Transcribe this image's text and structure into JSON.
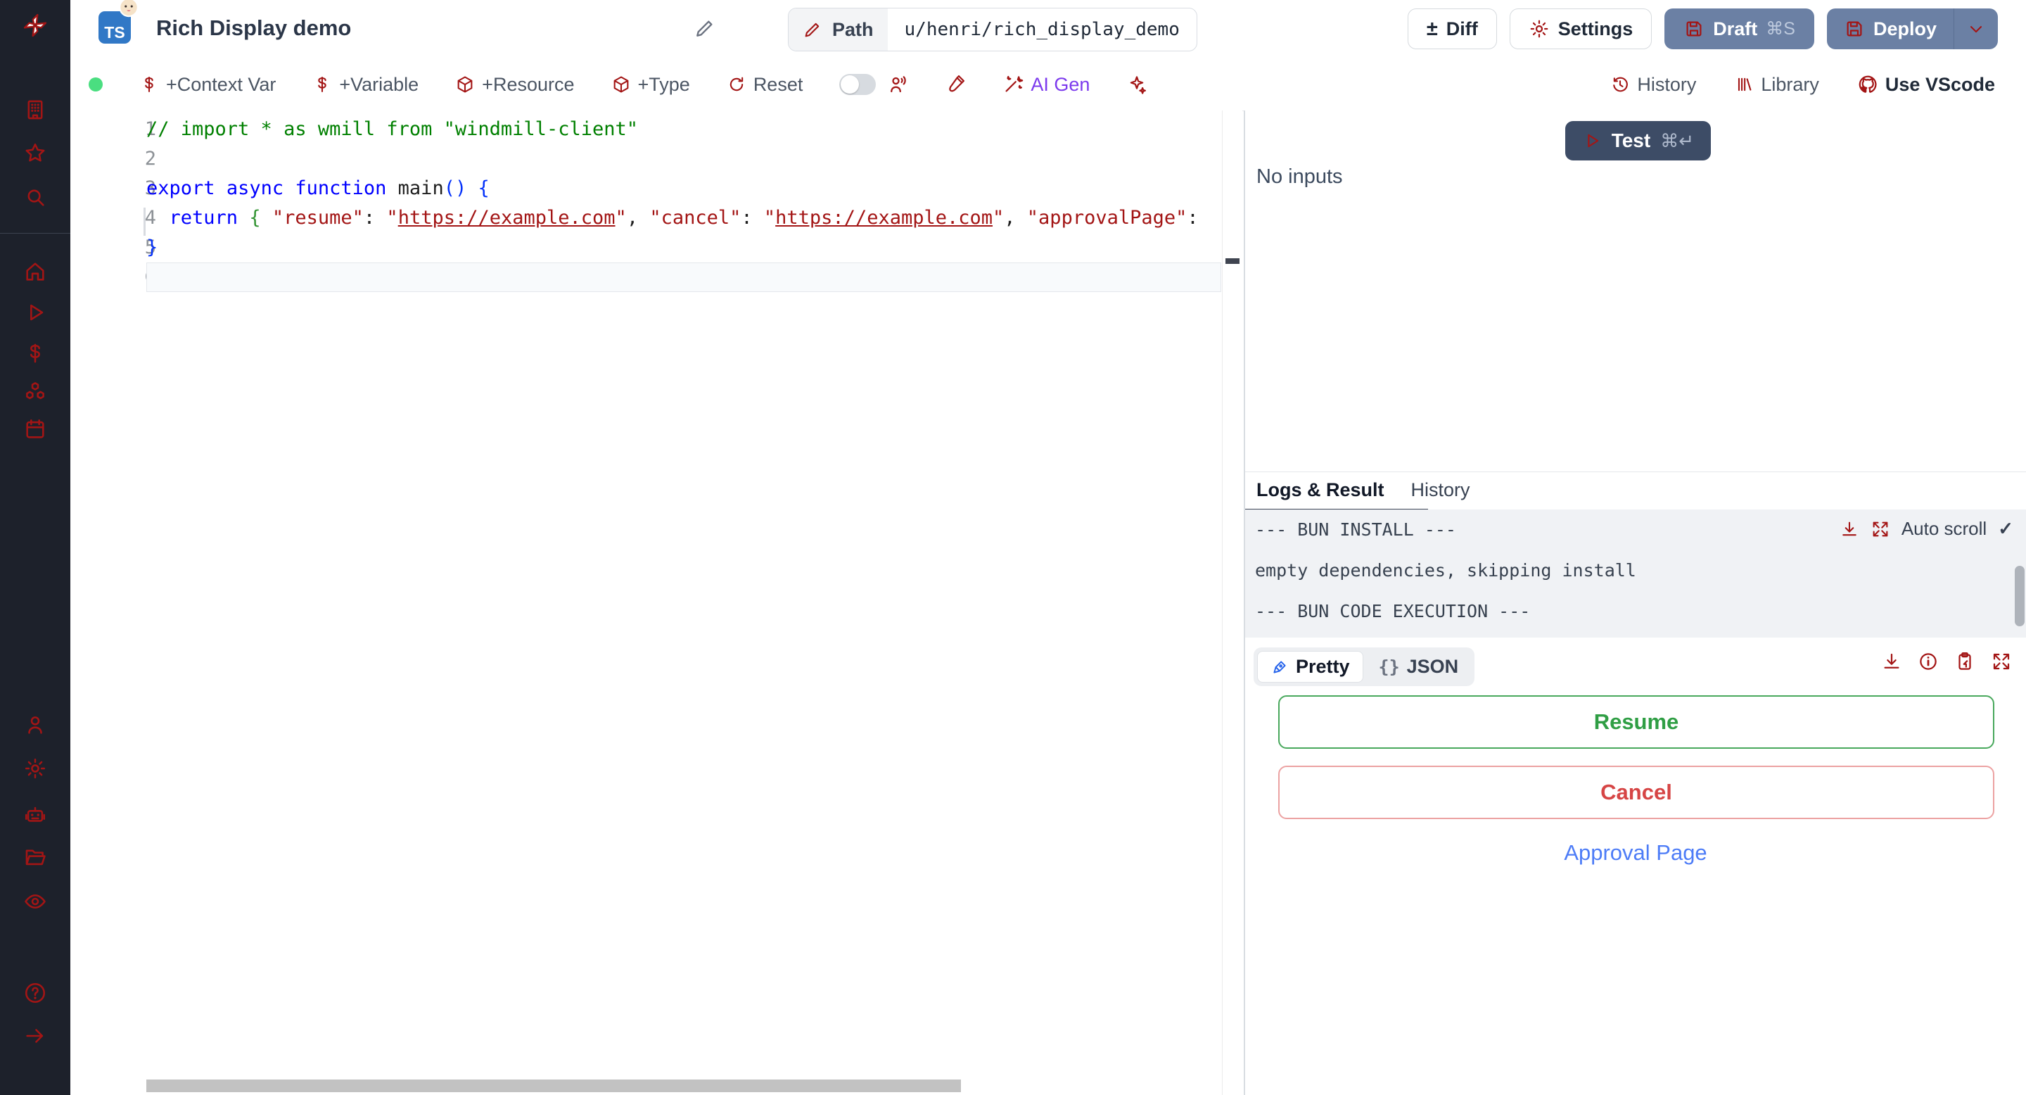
{
  "window": {
    "title": "Rich Display demo",
    "ts_badge": "TS"
  },
  "header": {
    "path_label": "Path",
    "path_value": "u/henri/rich_display_demo",
    "diff_label": "Diff",
    "settings_label": "Settings",
    "draft_label": "Draft",
    "draft_shortcut": "⌘S",
    "deploy_label": "Deploy"
  },
  "toolbar": {
    "context_var": "+Context Var",
    "variable": "+Variable",
    "resource": "+Resource",
    "type": "+Type",
    "reset": "Reset",
    "ai_gen": "AI Gen",
    "history": "History",
    "library": "Library",
    "vscode": "Use VScode"
  },
  "icons": {
    "diff_glyph": "±",
    "check_glyph": "✓",
    "dollar_glyph": "$",
    "sidebar_names": [
      "windmill-logo",
      "building",
      "star",
      "search",
      "home",
      "play",
      "dollar",
      "cubes",
      "calendar",
      "person",
      "gear",
      "robot",
      "folder-open",
      "eye",
      "question",
      "arrow-right"
    ]
  },
  "editor": {
    "lines": [
      {
        "n": "1",
        "tokens": [
          {
            "t": "// import * as wmill from \"windmill-client\"",
            "c": "cm"
          }
        ]
      },
      {
        "n": "2",
        "tokens": []
      },
      {
        "n": "3",
        "tokens": [
          {
            "t": "export",
            "c": "kw"
          },
          {
            "t": " ",
            "c": "pl"
          },
          {
            "t": "async",
            "c": "kw"
          },
          {
            "t": " ",
            "c": "pl"
          },
          {
            "t": "function",
            "c": "kw"
          },
          {
            "t": " ",
            "c": "pl"
          },
          {
            "t": "main",
            "c": "fn"
          },
          {
            "t": "()",
            "c": "b1"
          },
          {
            "t": " ",
            "c": "pl"
          },
          {
            "t": "{",
            "c": "b1"
          }
        ]
      },
      {
        "n": "4",
        "tokens": [
          {
            "t": "  ",
            "c": "pl"
          },
          {
            "t": "return",
            "c": "kw"
          },
          {
            "t": " ",
            "c": "pl"
          },
          {
            "t": "{",
            "c": "b2"
          },
          {
            "t": " ",
            "c": "pl"
          },
          {
            "t": "\"resume\"",
            "c": "st"
          },
          {
            "t": ": ",
            "c": "pl"
          },
          {
            "t": "\"",
            "c": "st"
          },
          {
            "t": "https://example.com",
            "c": "st lk"
          },
          {
            "t": "\"",
            "c": "st"
          },
          {
            "t": ", ",
            "c": "pl"
          },
          {
            "t": "\"cancel\"",
            "c": "st"
          },
          {
            "t": ": ",
            "c": "pl"
          },
          {
            "t": "\"",
            "c": "st"
          },
          {
            "t": "https://example.com",
            "c": "st lk"
          },
          {
            "t": "\"",
            "c": "st"
          },
          {
            "t": ", ",
            "c": "pl"
          },
          {
            "t": "\"approvalPage\"",
            "c": "st"
          },
          {
            "t": ":",
            "c": "pl"
          }
        ]
      },
      {
        "n": "5",
        "tokens": [
          {
            "t": "}",
            "c": "b1"
          }
        ]
      },
      {
        "n": "6",
        "tokens": [],
        "current": true
      }
    ]
  },
  "run": {
    "test_label": "Test",
    "test_shortcut": "⌘↵",
    "no_inputs": "No inputs"
  },
  "output": {
    "tabs": [
      {
        "label": "Logs & Result",
        "active": true
      },
      {
        "label": "History",
        "active": false
      }
    ],
    "auto_scroll": "Auto scroll",
    "logs": [
      "--- BUN INSTALL ---",
      "empty dependencies, skipping install",
      "--- BUN CODE EXECUTION ---"
    ],
    "view_pretty": "Pretty",
    "view_json_braces": "{}",
    "view_json": "JSON",
    "result": {
      "resume_label": "Resume",
      "cancel_label": "Cancel",
      "link_label": "Approval Page"
    }
  },
  "colors": {
    "resume_green": "#2f9e44",
    "cancel_red": "#d64545",
    "link_blue": "#4d7cf7",
    "header_button_slate": "#6b80a4",
    "test_navy": "#3d4c66",
    "ai_purple": "#7c3aed",
    "ts_badge_blue": "#3178c6",
    "sidebar_dark": "#1d212b",
    "status_dot_green": "#4ade80"
  }
}
